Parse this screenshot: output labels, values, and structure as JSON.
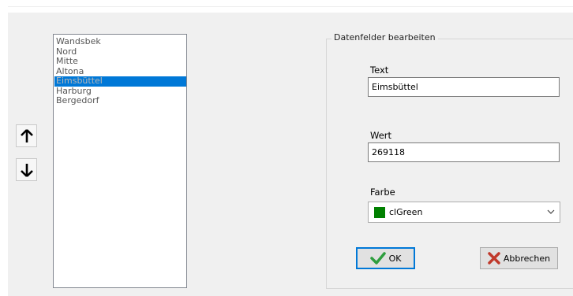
{
  "list": {
    "items": [
      "Wandsbek",
      "Nord",
      "Mitte",
      "Altona",
      "Eimsbüttel",
      "Harburg",
      "Bergedorf"
    ],
    "selected_index": 4
  },
  "move_buttons": {
    "up_icon": "arrow-up-icon",
    "down_icon": "arrow-down-icon"
  },
  "editor": {
    "group_title": "Datenfelder bearbeiten",
    "text_label": "Text",
    "text_value": "Eimsbüttel",
    "wert_label": "Wert",
    "wert_value": "269118",
    "farbe_label": "Farbe",
    "farbe_value": "clGreen",
    "farbe_color": "#008000"
  },
  "buttons": {
    "ok_label": "OK",
    "cancel_label": "Abbrechen"
  },
  "colors": {
    "selection": "#0078d7",
    "ok_check": "#2e9e3e",
    "cancel_x": "#c0392b"
  }
}
